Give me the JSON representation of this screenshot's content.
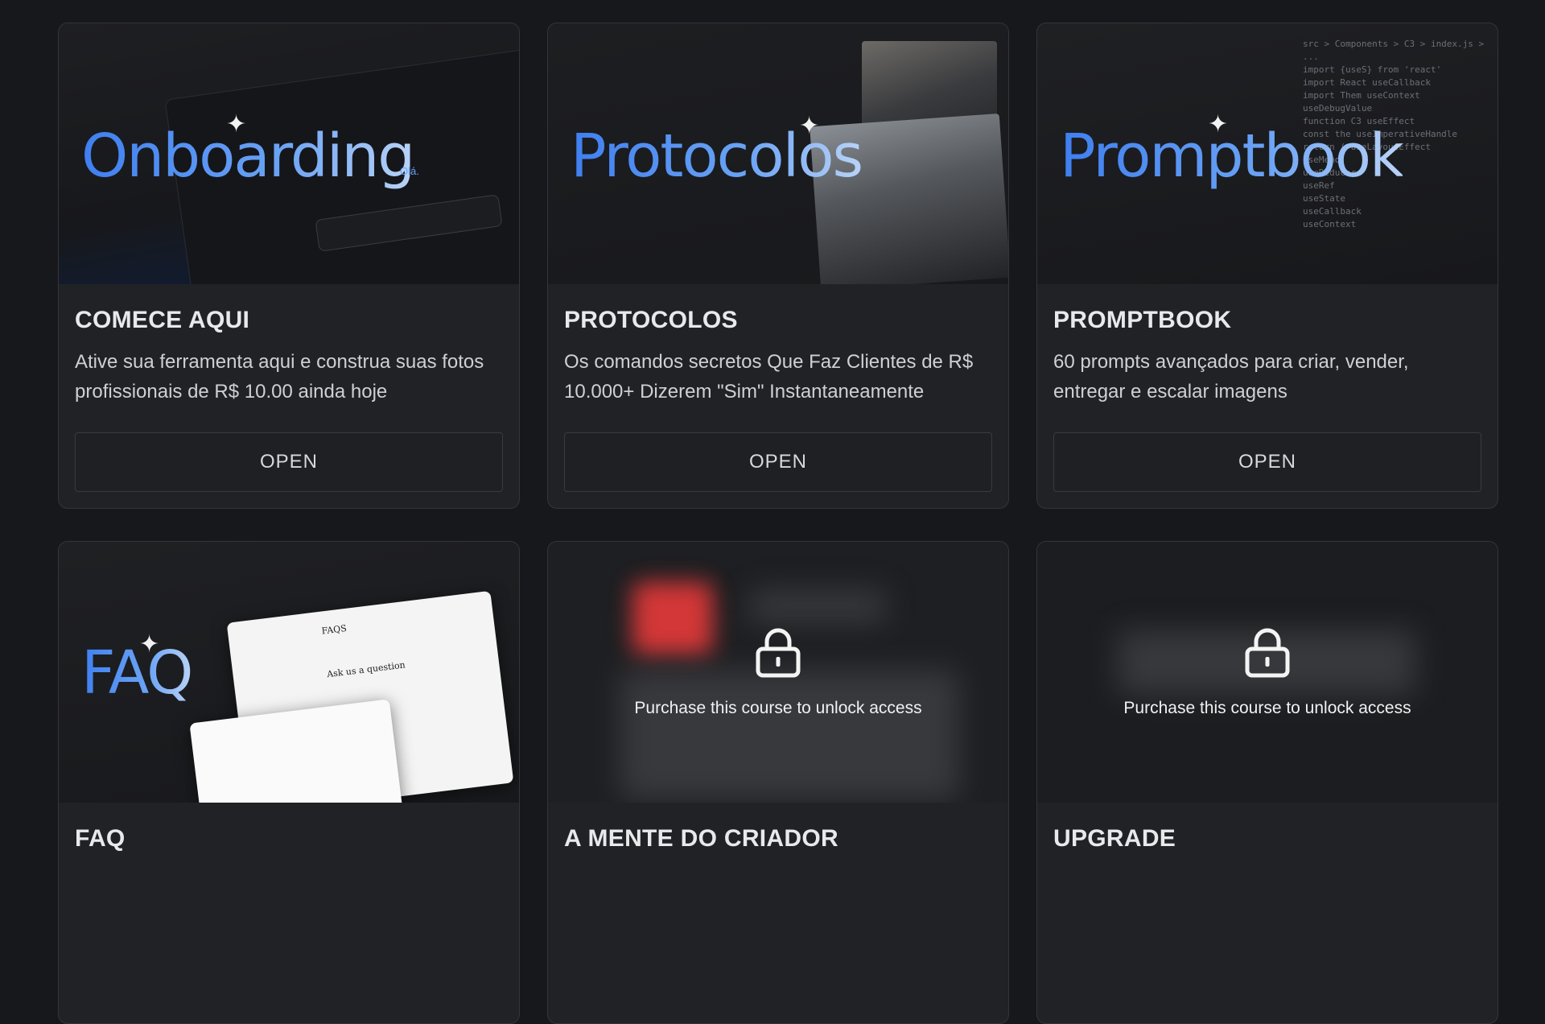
{
  "cards": [
    {
      "thumb_title": "Onboarding",
      "thumb_subtitle": "Olá.",
      "title": "COMECE AQUI",
      "description": "Ative sua ferramenta aqui e construa suas fotos profissionais de R$ 10.00 ainda hoje",
      "button": "OPEN"
    },
    {
      "thumb_title": "Protocolos",
      "title": "PROTOCOLOS",
      "description": "Os comandos secretos Que Faz Clientes de R$ 10.000+ Dizerem \"Sim\" Instantaneamente",
      "button": "OPEN"
    },
    {
      "thumb_title": "Promptbook",
      "title": "PROMPTBOOK",
      "description": "60 prompts avançados para criar, vender, entregar e escalar imagens",
      "button": "OPEN",
      "code_lines": [
        "src > Components > C3 > index.js > ...",
        "import {useS} from 'react'",
        "import React useCallback",
        "import Them useContext",
        "useDebugValue",
        "function C3 useEffect",
        "const the useImperativeHandle",
        "return ( useLayoutEffect",
        "useMemo",
        "useReducer",
        "useRef",
        "useState",
        "useCallback",
        "useContext"
      ]
    },
    {
      "thumb_title": "FAQ",
      "faq_sheet_title": "FAQS",
      "faq_question": "Ask us a question",
      "title": "FAQ"
    },
    {
      "title": "A MENTE DO CRIADOR",
      "lock_text": "Purchase this course to unlock access"
    },
    {
      "title": "UPGRADE",
      "lock_text": "Purchase this course to unlock access"
    }
  ],
  "colors": {
    "background": "#17181b",
    "card": "#212226",
    "accent_blue": "#3f7ff0"
  },
  "icons": {
    "lock": "lock-icon",
    "sparkle": "sparkle-icon"
  }
}
